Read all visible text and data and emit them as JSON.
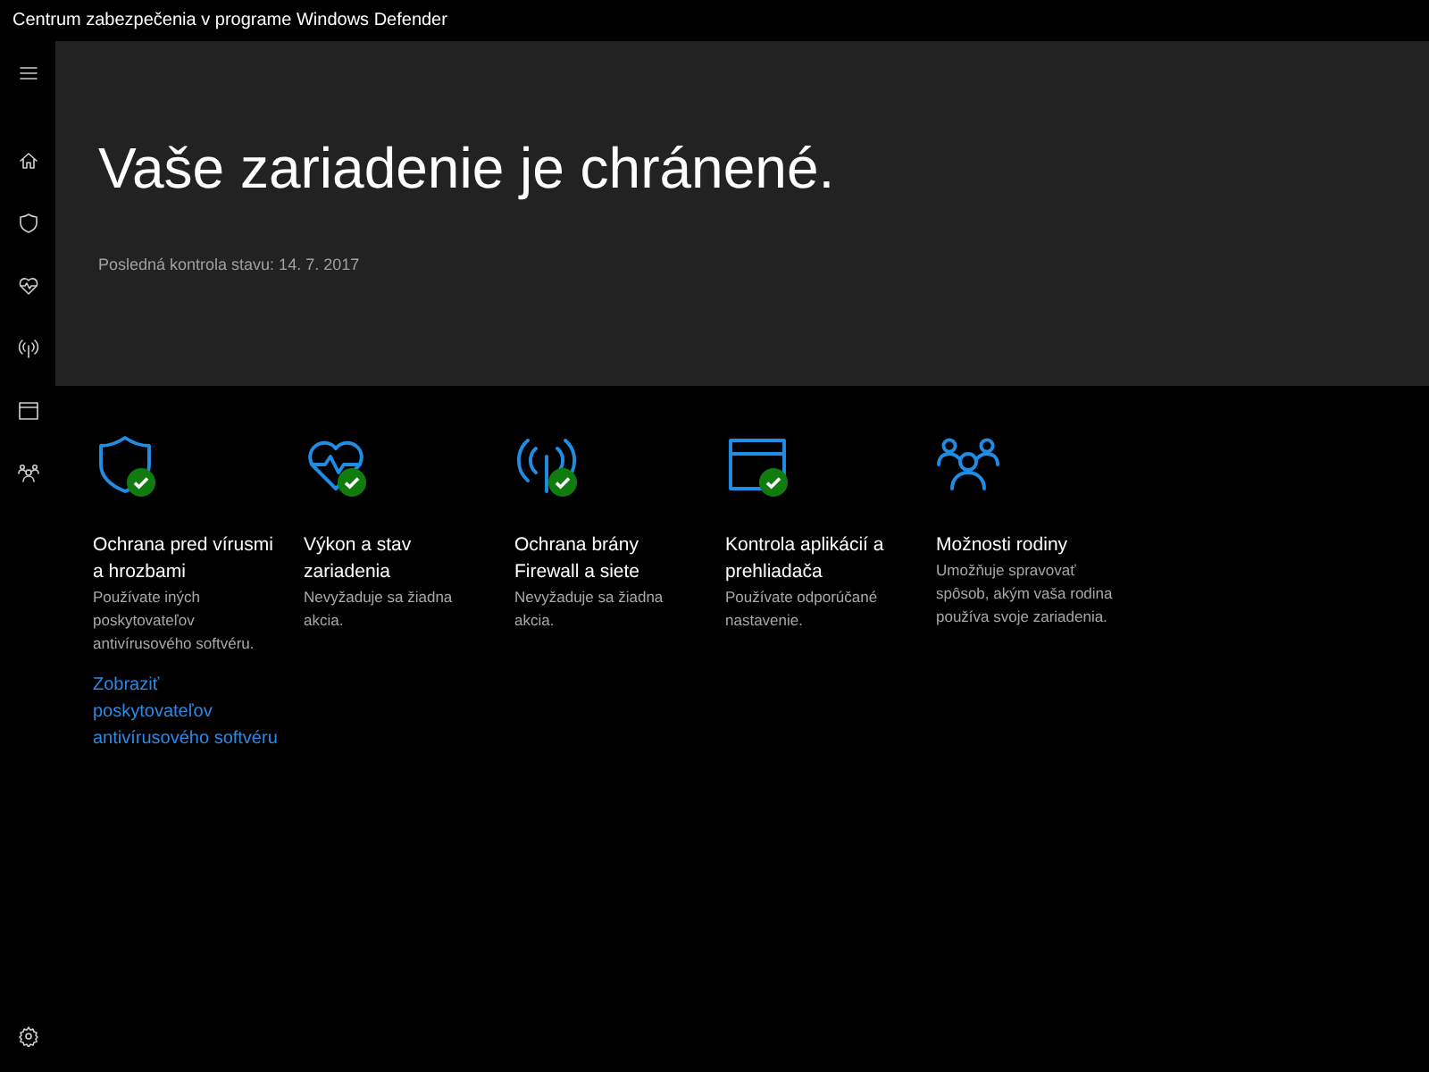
{
  "window": {
    "title": "Centrum zabezpečenia v programe Windows Defender"
  },
  "hero": {
    "heading": "Vaše zariadenie je chránené.",
    "subtitle": "Posledná kontrola stavu: 14. 7. 2017"
  },
  "sidebar": {
    "items": [
      {
        "kind": "menu"
      },
      {
        "kind": "home"
      },
      {
        "kind": "shield"
      },
      {
        "kind": "heart"
      },
      {
        "kind": "wifi"
      },
      {
        "kind": "browser"
      },
      {
        "kind": "family"
      }
    ],
    "footer": {
      "kind": "gear"
    }
  },
  "tiles": [
    {
      "kind": "shield",
      "checked": true,
      "title": "Ochrana pred vírusmi a hrozbami",
      "description": "Používate iných poskytovateľov antivírusového softvéru.",
      "link": "Zobraziť poskytovateľov antivírusového softvéru"
    },
    {
      "kind": "heart",
      "checked": true,
      "title": "Výkon a stav zariadenia",
      "description": "Nevyžaduje sa žiadna akcia."
    },
    {
      "kind": "wifi",
      "checked": true,
      "title": "Ochrana brány Firewall a siete",
      "description": "Nevyžaduje sa žiadna akcia."
    },
    {
      "kind": "browser",
      "checked": true,
      "title": "Kontrola aplikácií a prehliadača",
      "description": "Používate odporúčané nastavenie."
    },
    {
      "kind": "family",
      "checked": false,
      "title": "Možnosti rodiny",
      "description": "Umožňuje spravovať spôsob, akým vaša rodina používa svoje zariadenia."
    }
  ]
}
